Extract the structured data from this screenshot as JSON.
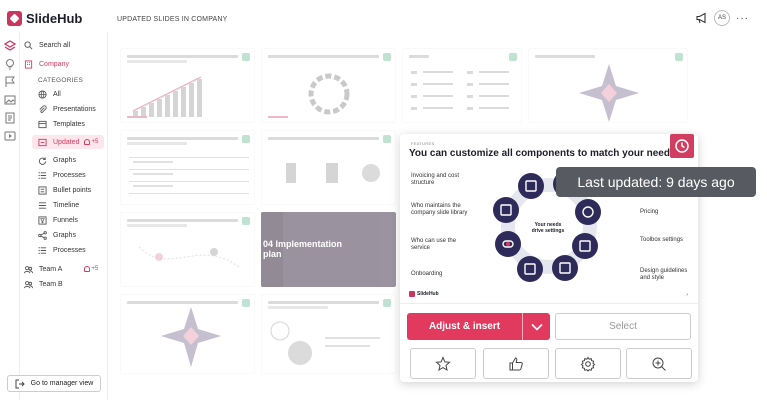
{
  "app": {
    "logo_text": "SlideHub"
  },
  "header": {
    "title": "UPDATED SLIDES IN COMPANY",
    "avatar_initials": "AS",
    "more_label": "···"
  },
  "sidebar": {
    "search_label": "Search all",
    "company_label": "Company",
    "categories_heading": "CATEGORIES",
    "items": [
      {
        "label": "All"
      },
      {
        "label": "Presentations"
      },
      {
        "label": "Templates"
      },
      {
        "label": "Updated",
        "badge": "+5"
      },
      {
        "label": "Graphs"
      },
      {
        "label": "Processes"
      },
      {
        "label": "Bullet points"
      },
      {
        "label": "Timeline"
      },
      {
        "label": "Funnels"
      },
      {
        "label": "Graphs"
      },
      {
        "label": "Processes"
      }
    ],
    "team_a": {
      "label": "Team A",
      "badge": "+5"
    },
    "team_b": {
      "label": "Team B"
    },
    "manager_button": "Go to manager view"
  },
  "grid_thumb": {
    "dark_heading": "04 Implementation plan"
  },
  "preview": {
    "tag": "FEATURES",
    "title": "You can customize all components to match your needs",
    "center_text": "Your needs drive settings",
    "left_labels": [
      "Invoicing and cost structure",
      "Who maintains the company slide library",
      "Who can use the service",
      "Onboarding"
    ],
    "right_labels": [
      "Pricing",
      "Toolbox settings",
      "Design guidelines and style"
    ],
    "footer_logo": "SlideHub",
    "tooltip": "Last updated: 9 days ago",
    "adjust_button": "Adjust & insert",
    "select_button": "Select",
    "icon_buttons": [
      "star-icon",
      "thumbs-up-icon",
      "gear-icon",
      "zoom-in-icon"
    ],
    "accent_color": "#e23a5f"
  }
}
